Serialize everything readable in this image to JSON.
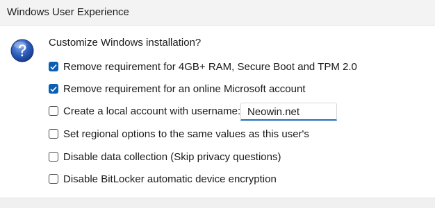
{
  "window": {
    "title": "Windows User Experience"
  },
  "dialog": {
    "icon": "question-icon",
    "prompt": "Customize Windows installation?",
    "accent_color": "#0a5fb4",
    "options": [
      {
        "label": "Remove requirement for 4GB+ RAM, Secure Boot and TPM 2.0",
        "checked": true
      },
      {
        "label": "Remove requirement for an online Microsoft account",
        "checked": true
      },
      {
        "label": "Create a local account with username:",
        "checked": false
      },
      {
        "label": "Set regional options to the same values as this user's",
        "checked": false
      },
      {
        "label": "Disable data collection (Skip privacy questions)",
        "checked": false
      },
      {
        "label": "Disable BitLocker automatic device encryption",
        "checked": false
      }
    ],
    "username_value": "Neowin.net"
  }
}
